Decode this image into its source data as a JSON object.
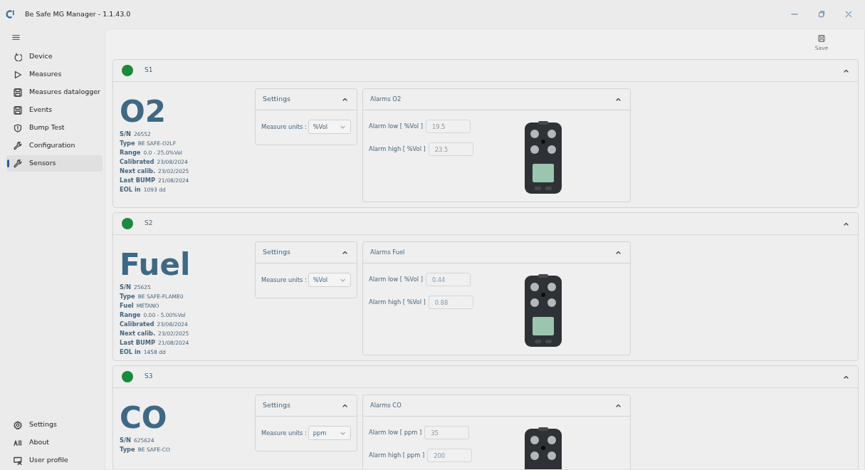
{
  "window": {
    "title": "Be Safe MG Manager - 1.1.43.0"
  },
  "sidebar": {
    "items": [
      {
        "label": "Device",
        "selected": false
      },
      {
        "label": "Measures",
        "selected": false
      },
      {
        "label": "Measures datalogger",
        "selected": false
      },
      {
        "label": "Events",
        "selected": false
      },
      {
        "label": "Bump Test",
        "selected": false
      },
      {
        "label": "Configuration",
        "selected": false
      },
      {
        "label": "Sensors",
        "selected": true
      }
    ],
    "footer_items": [
      {
        "label": "Settings",
        "selected": false
      },
      {
        "label": "About",
        "selected": false
      },
      {
        "label": "User profile",
        "selected": false
      }
    ]
  },
  "toolbar": {
    "save_label": "Save"
  },
  "sensors": [
    {
      "slot": "S1",
      "expanded": true,
      "gas": "O2",
      "info": [
        {
          "label": "S/N",
          "value": "26552"
        },
        {
          "label": "Type",
          "value": "BE SAFE-O2LF"
        },
        {
          "label": "Range",
          "value": "0.0 - 25.0%Vol"
        },
        {
          "label": "Calibrated",
          "value": "23/08/2024"
        },
        {
          "label": "Next calib.",
          "value": "23/02/2025"
        },
        {
          "label": "Last BUMP",
          "value": "21/08/2024"
        },
        {
          "label": "EOL in",
          "value": "1093 dd"
        }
      ],
      "settings": {
        "title": "Settings",
        "expanded": true,
        "units_label": "Measure units :",
        "units": "%Vol"
      },
      "alarms": {
        "title": "Alarms O2",
        "expanded": true,
        "low_label": "Alarm low  [ %Vol ]",
        "low": "19.5",
        "high_label": "Alarm high  [ %Vol ]",
        "high": "23.5"
      }
    },
    {
      "slot": "S2",
      "expanded": true,
      "gas": "Fuel",
      "info": [
        {
          "label": "S/N",
          "value": "25625"
        },
        {
          "label": "Type",
          "value": "BE SAFE-FLAME0"
        },
        {
          "label": "Fuel",
          "value": "METANO"
        },
        {
          "label": "Range",
          "value": "0.00 - 5.00%Vol"
        },
        {
          "label": "Calibrated",
          "value": "23/08/2024"
        },
        {
          "label": "Next calib.",
          "value": "23/02/2025"
        },
        {
          "label": "Last BUMP",
          "value": "21/08/2024"
        },
        {
          "label": "EOL in",
          "value": "1458 dd"
        }
      ],
      "settings": {
        "title": "Settings",
        "expanded": true,
        "units_label": "Measure units :",
        "units": "%Vol"
      },
      "alarms": {
        "title": "Alarms Fuel",
        "expanded": true,
        "low_label": "Alarm low  [ %Vol ]",
        "low": "0.44",
        "high_label": "Alarm high  [ %Vol ]",
        "high": "0.88"
      }
    },
    {
      "slot": "S3",
      "expanded": true,
      "gas": "CO",
      "info": [
        {
          "label": "S/N",
          "value": "625624"
        },
        {
          "label": "Type",
          "value": "BE SAFE-CO"
        }
      ],
      "settings": {
        "title": "Settings",
        "expanded": true,
        "units_label": "Measure units :",
        "units": "ppm"
      },
      "alarms": {
        "title": "Alarms CO",
        "expanded": true,
        "low_label": "Alarm low  [ ppm ]",
        "low": "35",
        "high_label": "Alarm high  [ ppm ]",
        "high": "200"
      }
    }
  ]
}
